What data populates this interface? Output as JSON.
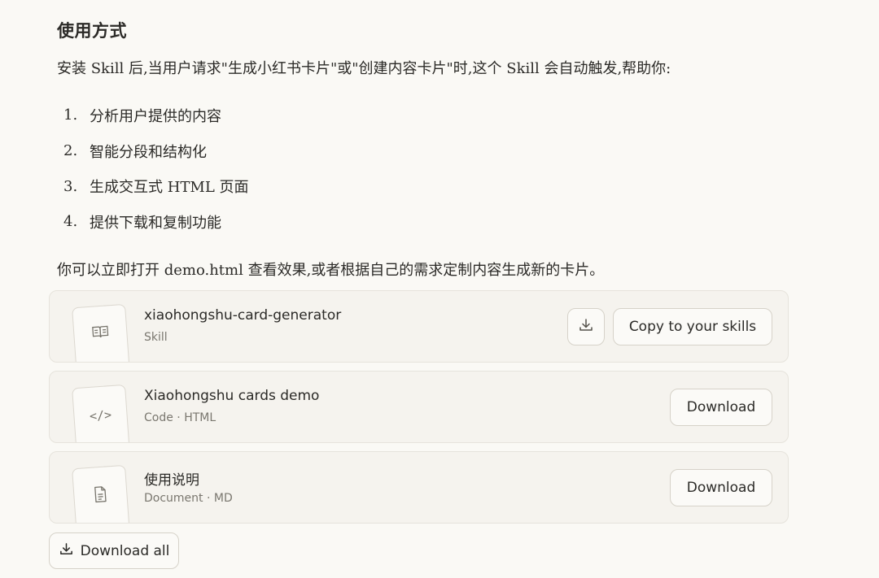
{
  "section": {
    "heading": "使用方式",
    "intro": "安装 Skill 后,当用户请求\"生成小红书卡片\"或\"创建内容卡片\"时,这个 Skill 会自动触发,帮助你:",
    "steps": [
      {
        "num": "1.",
        "text": "分析用户提供的内容"
      },
      {
        "num": "2.",
        "text": "智能分段和结构化"
      },
      {
        "num": "3.",
        "text": "生成交互式 HTML 页面"
      },
      {
        "num": "4.",
        "text": "提供下载和复制功能"
      }
    ],
    "outro": "你可以立即打开 demo.html 查看效果,或者根据自己的需求定制内容生成新的卡片。"
  },
  "files": [
    {
      "title": "xiaohongshu-card-generator",
      "subtitle": "Skill",
      "icon": "book-icon",
      "action_label": "Copy to your skills",
      "secondary_icon": "download-icon"
    },
    {
      "title": "Xiaohongshu cards demo",
      "subtitle": "Code · HTML",
      "icon": "code-icon",
      "icon_glyph": "</>",
      "action_label": "Download"
    },
    {
      "title": "使用说明",
      "subtitle": "Document · MD",
      "icon": "document-icon",
      "action_label": "Download"
    }
  ],
  "download_all_label": "Download all"
}
